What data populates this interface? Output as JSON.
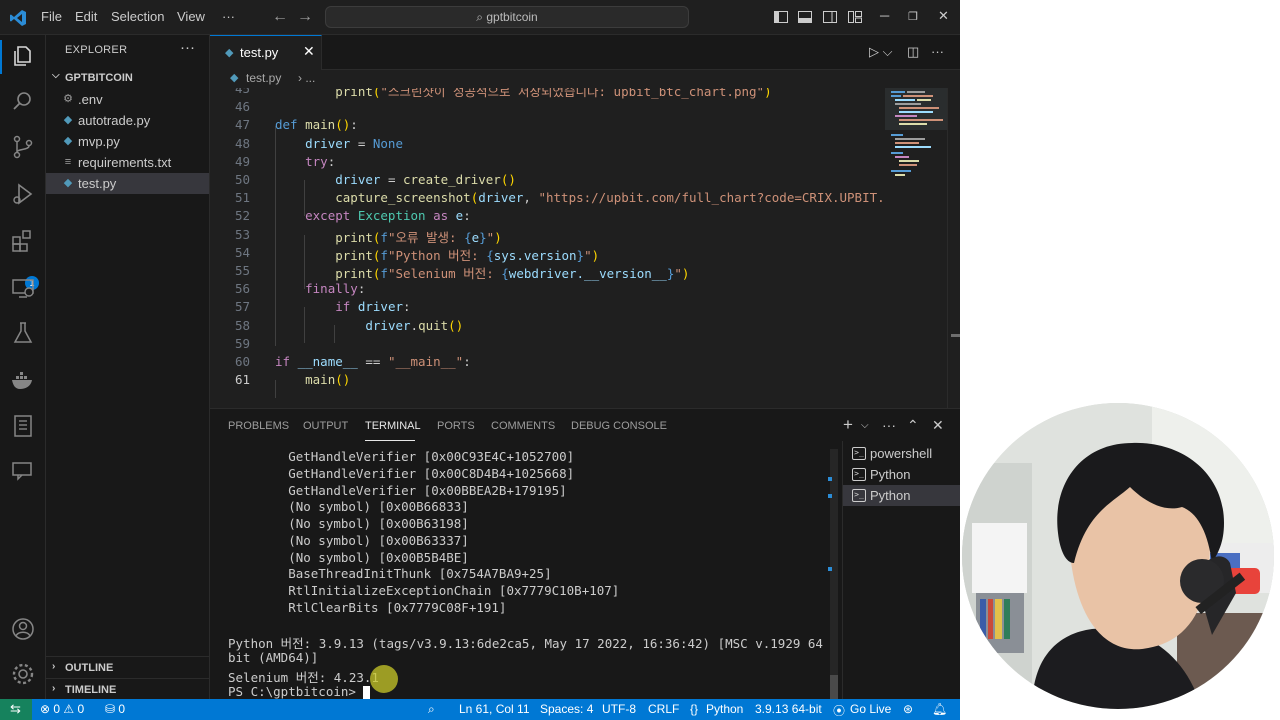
{
  "titlebar": {
    "menu": [
      "File",
      "Edit",
      "Selection",
      "View",
      "···"
    ],
    "search": "gptbitcoin"
  },
  "sidebar": {
    "title": "EXPLORER",
    "more": "···",
    "folder": "GPTBITCOIN",
    "files": [
      {
        "name": ".env",
        "icon": "gear-icon"
      },
      {
        "name": "autotrade.py",
        "icon": "python-icon"
      },
      {
        "name": "mvp.py",
        "icon": "python-icon"
      },
      {
        "name": "requirements.txt",
        "icon": "text-file-icon"
      },
      {
        "name": "test.py",
        "icon": "python-icon",
        "active": true
      }
    ],
    "sections": [
      "OUTLINE",
      "TIMELINE"
    ]
  },
  "activity": {
    "extensions_badge": "1"
  },
  "editor": {
    "tab": {
      "name": "test.py",
      "close": "✕"
    },
    "breadcrumb": {
      "file": "test.py",
      "sep": "› ..."
    },
    "current_line": "61",
    "lines": [
      {
        "n": "45",
        "text": "        print(\"스크린샷이 성공적으로 저장되었습니다: upbit_btc_chart.png\")"
      },
      {
        "n": "46",
        "text": ""
      },
      {
        "n": "47",
        "text": "def main():"
      },
      {
        "n": "48",
        "text": "    driver = None"
      },
      {
        "n": "49",
        "text": "    try:"
      },
      {
        "n": "50",
        "text": "        driver = create_driver()"
      },
      {
        "n": "51",
        "text": "        capture_screenshot(driver, \"https://upbit.com/full_chart?code=CRIX.UPBIT.KRW-BTC\")"
      },
      {
        "n": "52",
        "text": "    except Exception as e:"
      },
      {
        "n": "53",
        "text": "        print(f\"오류 발생: {e}\")"
      },
      {
        "n": "54",
        "text": "        print(f\"Python 버전: {sys.version}\")"
      },
      {
        "n": "55",
        "text": "        print(f\"Selenium 버전: {webdriver.__version__}\")"
      },
      {
        "n": "56",
        "text": "    finally:"
      },
      {
        "n": "57",
        "text": "        if driver:"
      },
      {
        "n": "58",
        "text": "            driver.quit()"
      },
      {
        "n": "59",
        "text": ""
      },
      {
        "n": "60",
        "text": "if __name__ == \"__main__\":"
      },
      {
        "n": "61",
        "text": "    main()"
      }
    ]
  },
  "panel": {
    "tabs": [
      "PROBLEMS",
      "OUTPUT",
      "TERMINAL",
      "PORTS",
      "COMMENTS",
      "DEBUG CONSOLE"
    ],
    "active_tab": "TERMINAL",
    "terminal_lines": [
      "        GetHandleVerifier [0x00C93E4C+1052700]",
      "        GetHandleVerifier [0x00C8D4B4+1025668]",
      "        GetHandleVerifier [0x00BBEA2B+179195]",
      "        (No symbol) [0x00B66833]",
      "        (No symbol) [0x00B63198]",
      "        (No symbol) [0x00B63337]",
      "        (No symbol) [0x00B5B4BE]",
      "        BaseThreadInitThunk [0x754A7BA9+25]",
      "        RtlInitializeExceptionChain [0x7779C10B+107]",
      "        RtlClearBits [0x7779C08F+191]",
      "",
      "Python 버전: 3.9.13 (tags/v3.9.13:6de2ca5, May 17 2022, 16:36:42) [MSC v.1929 64",
      "bit (AMD64)]",
      "Selenium 버전: 4.23.1",
      "PS C:\\gptbitcoin> "
    ],
    "terminals": [
      {
        "name": "powershell",
        "active": false
      },
      {
        "name": "Python",
        "active": false
      },
      {
        "name": "Python",
        "active": true
      }
    ]
  },
  "statusbar": {
    "problems": "⊗ 0 ⚠ 0",
    "ports": "⛁ 0",
    "position": "Ln 61, Col 11",
    "spaces": "Spaces: 4",
    "encoding": "UTF-8",
    "eol": "CRLF",
    "language": "Python",
    "interpreter": "3.9.13 64-bit",
    "golive": "Go Live"
  }
}
